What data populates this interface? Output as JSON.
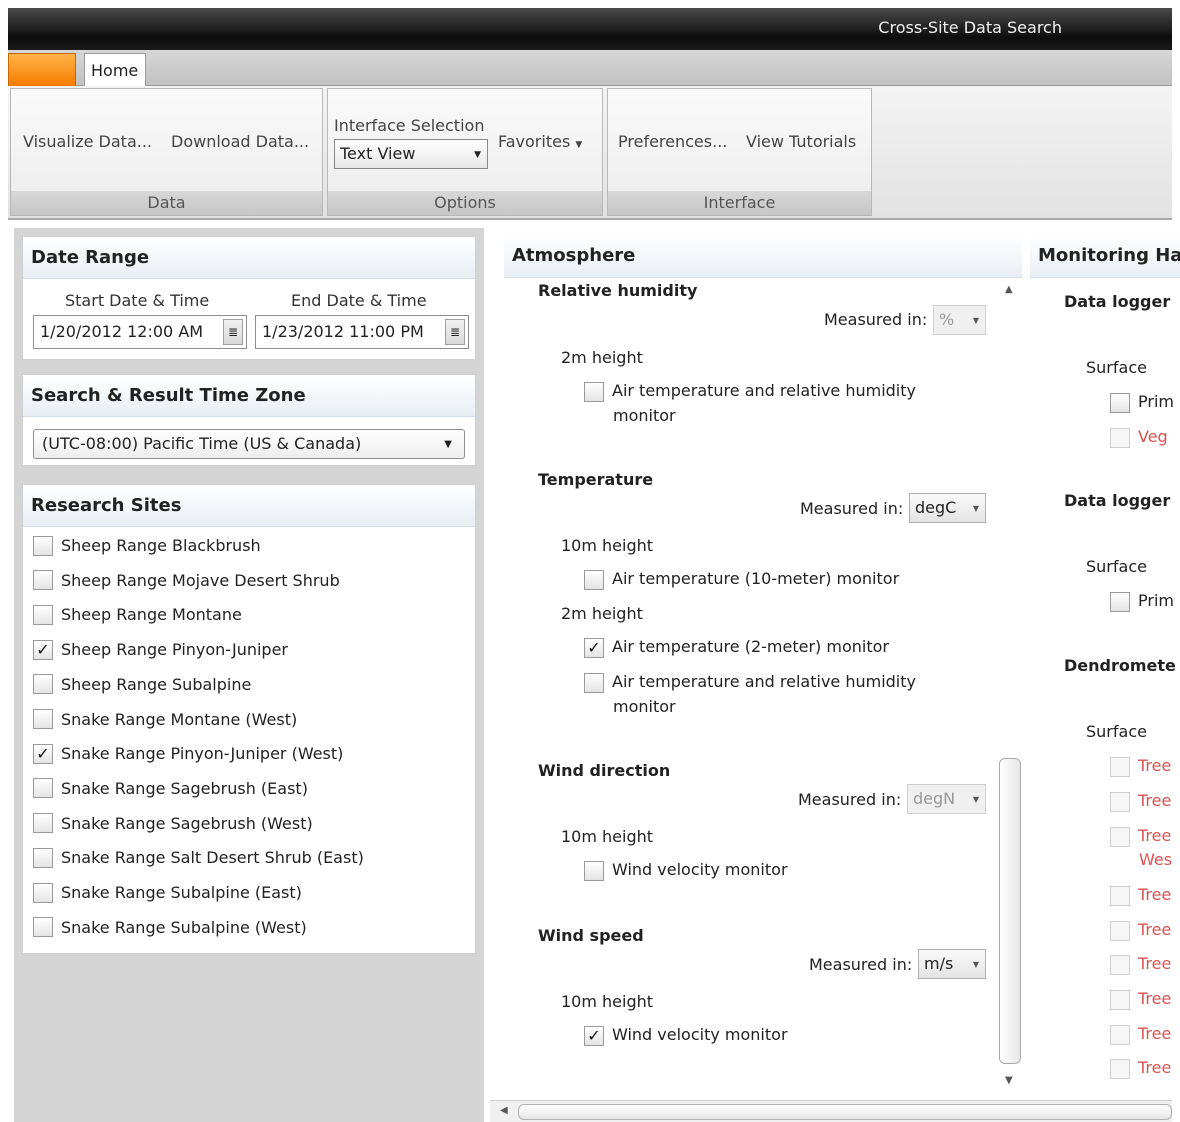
{
  "window": {
    "title": "Cross-Site Data Search"
  },
  "tabs": {
    "home": "Home"
  },
  "ribbon": {
    "data_group": {
      "label": "Data",
      "visualize": "Visualize Data...",
      "download": "Download Data..."
    },
    "options_group": {
      "label": "Options",
      "interface_selection_label": "Interface Selection",
      "interface_selection_value": "Text View",
      "favorites": "Favorites"
    },
    "interface_group": {
      "label": "Interface",
      "preferences": "Preferences...",
      "tutorials": "View Tutorials"
    }
  },
  "date_range": {
    "title": "Date Range",
    "start_label": "Start Date & Time",
    "end_label": "End Date & Time",
    "start_value": "1/20/2012 12:00 AM",
    "end_value": "1/23/2012 11:00 PM"
  },
  "timezone": {
    "title": "Search & Result Time Zone",
    "value": "(UTC-08:00) Pacific Time (US & Canada)"
  },
  "research_sites": {
    "title": "Research Sites",
    "sites": [
      {
        "label": "Sheep Range Blackbrush",
        "checked": false
      },
      {
        "label": "Sheep Range Mojave Desert Shrub",
        "checked": false
      },
      {
        "label": "Sheep Range Montane",
        "checked": false
      },
      {
        "label": "Sheep Range Pinyon-Juniper",
        "checked": true
      },
      {
        "label": "Sheep Range Subalpine",
        "checked": false
      },
      {
        "label": "Snake Range Montane (West)",
        "checked": false
      },
      {
        "label": "Snake Range Pinyon-Juniper (West)",
        "checked": true
      },
      {
        "label": "Snake Range Sagebrush (East)",
        "checked": false
      },
      {
        "label": "Snake Range Sagebrush (West)",
        "checked": false
      },
      {
        "label": "Snake Range Salt Desert Shrub (East)",
        "checked": false
      },
      {
        "label": "Snake Range Subalpine (East)",
        "checked": false
      },
      {
        "label": "Snake Range Subalpine (West)",
        "checked": false
      }
    ]
  },
  "atmosphere": {
    "title": "Atmosphere",
    "measured_in_label": "Measured in:",
    "relative_humidity": {
      "title": "Relative humidity",
      "unit": "%",
      "height": "2m height",
      "monitor_line1": "Air temperature and relative humidity",
      "monitor_line2": "monitor",
      "checked": false
    },
    "temperature": {
      "title": "Temperature",
      "unit": "degC",
      "height_10m": "10m height",
      "monitor_10m": "Air temperature (10-meter) monitor",
      "checked_10m": false,
      "height_2m": "2m height",
      "monitor_2m": "Air temperature (2-meter) monitor",
      "checked_2m": true,
      "monitor_rh_line1": "Air temperature and relative humidity",
      "monitor_rh_line2": "monitor",
      "checked_rh": false
    },
    "wind_direction": {
      "title": "Wind direction",
      "unit": "degN",
      "height": "10m height",
      "monitor": "Wind velocity monitor",
      "checked": false
    },
    "wind_speed": {
      "title": "Wind speed",
      "unit": "m/s",
      "height": "10m height",
      "monitor": "Wind velocity monitor",
      "checked": true
    }
  },
  "monitoring": {
    "title": "Monitoring Ha",
    "data_logger_1": "Data logger",
    "surface_1": "Surface",
    "prim_1": "Prim",
    "veg_1": "Veg",
    "data_logger_2": "Data logger",
    "surface_2": "Surface",
    "prim_2": "Prim",
    "dendrometer": "Dendromete",
    "surface_3": "Surface",
    "tree_items": [
      "Tree",
      "Tree",
      "Tree",
      "Wes",
      "Tree",
      "Tree",
      "Tree",
      "Tree",
      "Tree",
      "Tree"
    ]
  },
  "colors": {
    "accent_orange": "#f57c00",
    "disabled_red": "#d9534f"
  }
}
